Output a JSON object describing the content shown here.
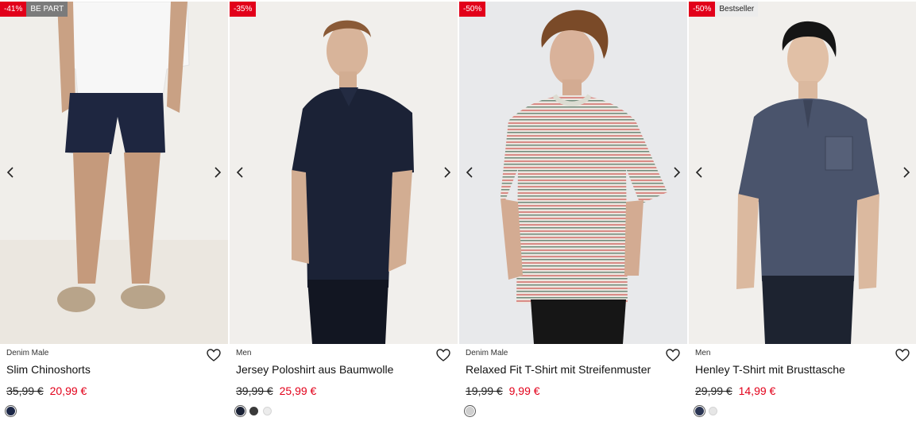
{
  "products": [
    {
      "brand": "Denim Male",
      "name": "Slim Chinoshorts",
      "old_price": "35,99 €",
      "new_price": "20,99 €",
      "badges": [
        {
          "text": "-41%",
          "kind": "sale"
        },
        {
          "text": "BE PART",
          "kind": "grey"
        }
      ],
      "swatches": [
        "#1c2747"
      ],
      "selected_swatch": 0
    },
    {
      "brand": "Men",
      "name": "Jersey Poloshirt aus Baumwolle",
      "old_price": "39,99 €",
      "new_price": "25,99 €",
      "badges": [
        {
          "text": "-35%",
          "kind": "sale"
        }
      ],
      "swatches": [
        "#1b2236",
        "#3a3a3a",
        "#ececec"
      ],
      "selected_swatch": 0
    },
    {
      "brand": "Denim Male",
      "name": "Relaxed Fit T-Shirt mit Streifenmuster",
      "old_price": "19,99 €",
      "new_price": "9,99 €",
      "badges": [
        {
          "text": "-50%",
          "kind": "sale"
        }
      ],
      "swatches": [
        "#cfcfcf"
      ],
      "selected_swatch": 0
    },
    {
      "brand": "Men",
      "name": "Henley T-Shirt mit Brusttasche",
      "old_price": "29,99 €",
      "new_price": "14,99 €",
      "badges": [
        {
          "text": "-50%",
          "kind": "sale"
        },
        {
          "text": "Bestseller",
          "kind": "light"
        }
      ],
      "swatches": [
        "#2b3553",
        "#e6e6e6"
      ],
      "selected_swatch": 0
    }
  ],
  "icons": {
    "prev": "chevron-left-icon",
    "next": "chevron-right-icon",
    "wishlist": "heart-icon"
  },
  "colors": {
    "sale_red": "#e2001a",
    "badge_grey": "#7b7b7b"
  }
}
